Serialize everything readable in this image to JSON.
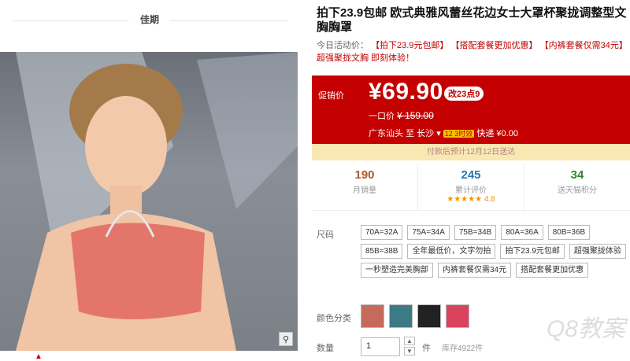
{
  "brand": {
    "name": "佳期"
  },
  "product": {
    "title": "拍下23.9包邮 欧式典雅风蕾丝花边女士大罩杯聚拢调整型文胸胸罩",
    "activity_prefix": "今日活动价：",
    "activity_items": [
      "【拍下23.9元包邮】",
      "【搭配套餐更加优惠】",
      "【内裤套餐仅需34元】",
      "超强聚拢文胸 即刻体验！"
    ]
  },
  "price": {
    "label": "促销价",
    "value": "¥69.90",
    "badge": "改23点9",
    "orig_label": "一口价",
    "orig_value": "¥ 159.00",
    "ship_from": "广东汕头",
    "ship_to_prefix": "至",
    "ship_to": "长沙",
    "ship_tag": "12 3时效",
    "ship_fee": "快递 ¥0.00"
  },
  "delivery": "付款后预计12月12日送达",
  "stats": [
    {
      "num": "190",
      "label": "月销量",
      "color": "#b05a2a"
    },
    {
      "num": "245",
      "label": "累计评价",
      "color": "#2a7ab0",
      "rating": "4.8"
    },
    {
      "num": "34",
      "label": "送天猫积分",
      "color": "#2a8a2a"
    }
  ],
  "options": {
    "size_label": "尺码",
    "sizes": [
      "70A=32A",
      "75A=34A",
      "75B=34B",
      "80A=36A",
      "80B=36B",
      "85B=38B",
      "全年最低价，文字勿拍",
      "拍下23.9元包邮",
      "超强聚拢体验",
      "一秒塑造完美胸部",
      "内裤套餐仅需34元",
      "搭配套餐更加优惠"
    ],
    "color_label": "颜色分类",
    "qty_label": "数量",
    "qty_value": "1",
    "unit": "件",
    "stock": "库存4922件"
  },
  "icons": {
    "zoom": "magnifier-icon",
    "up": "up-arrow-icon"
  },
  "watermark": "Q8教案"
}
